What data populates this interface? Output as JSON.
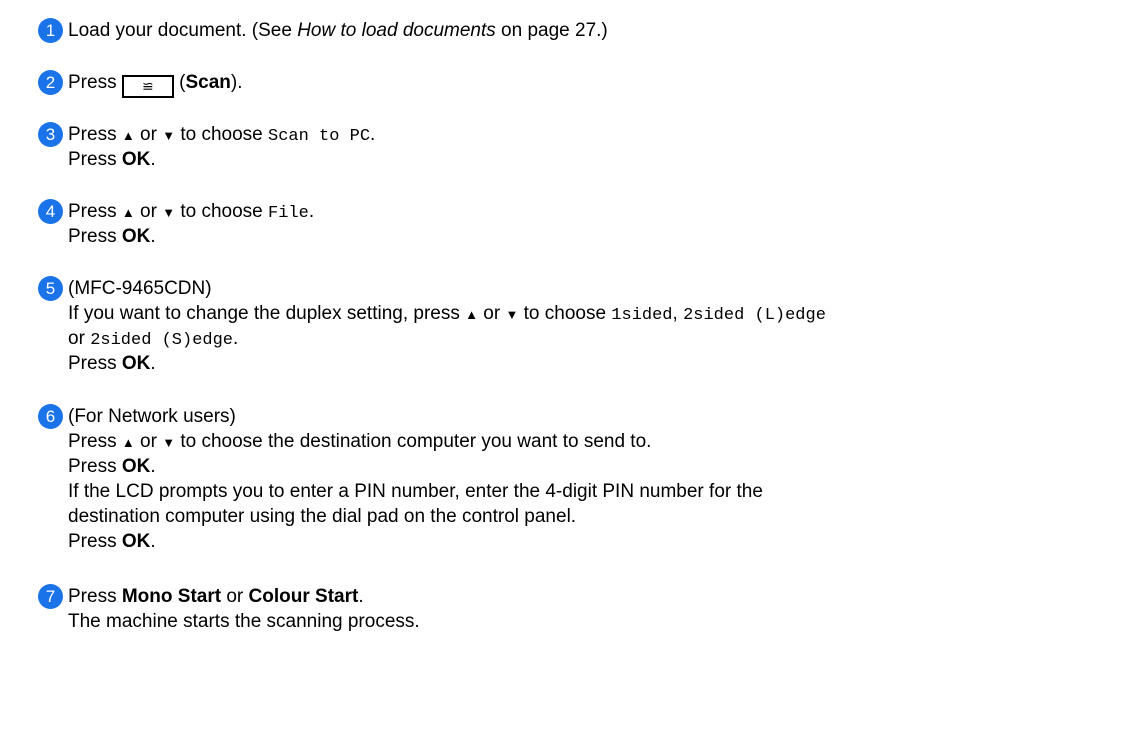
{
  "accent_color": "#1a73e8",
  "steps": [
    {
      "number": "1",
      "text_a": "Load your document. (See ",
      "ref": "How to load documents",
      "text_b": " on page 27.)"
    },
    {
      "number": "2",
      "press": "Press ",
      "icon": "scan-key-icon",
      "paren_open": " (",
      "scan": "Scan",
      "paren_close": ")."
    },
    {
      "number": "3",
      "press": "Press ",
      "or": " or ",
      "choose": " to choose ",
      "value": "Scan to PC",
      "dot": ".",
      "press_ok": "Press ",
      "ok": "OK",
      "ok_dot": "."
    },
    {
      "number": "4",
      "press": "Press ",
      "or": " or ",
      "choose": " to choose ",
      "value": "File",
      "dot": ".",
      "press_ok": "Press ",
      "ok": "OK",
      "ok_dot": "."
    },
    {
      "number": "5",
      "model": "(MFC-9465CDN)",
      "text_a": "If you want to change the duplex setting, press ",
      "or": " or ",
      "choose": " to choose ",
      "opt1": "1sided",
      "comma": ", ",
      "opt2": "2sided (L)edge",
      "or2": "or ",
      "opt3": "2sided (S)edge",
      "dot": ".",
      "press_ok": "Press ",
      "ok": "OK",
      "ok_dot": "."
    },
    {
      "number": "6",
      "heading": "(For Network users)",
      "press": "Press ",
      "or": " or ",
      "choose_dest": " to choose the destination computer you want to send to.",
      "press_ok": "Press ",
      "ok": "OK",
      "ok_dot": ".",
      "pin1": "If the LCD prompts you to enter a PIN number, enter the 4-digit PIN number for the",
      "pin2": "destination computer using the dial pad on the control panel.",
      "press_ok2": "Press ",
      "ok2": "OK",
      "ok_dot2": "."
    },
    {
      "number": "7",
      "press": "Press ",
      "mono": "Mono Start",
      "or": " or ",
      "colour": "Colour Start",
      "dot": ".",
      "result": "The machine starts the scanning process."
    }
  ]
}
